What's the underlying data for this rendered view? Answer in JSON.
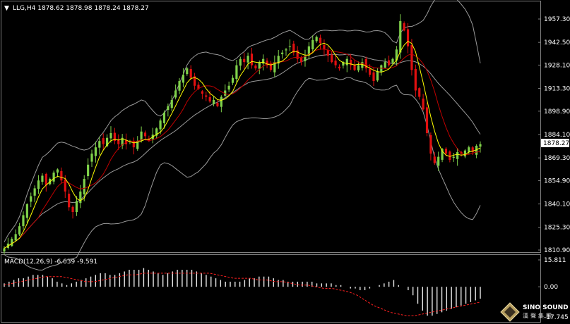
{
  "chart_header": {
    "symbol_arrow": "▼",
    "text": "LLG,H4 1878.62 1878.98 1878.24 1878.27"
  },
  "macd_header": {
    "text": "MACD(12,26,9) -6.639 -9.591"
  },
  "price_axis": {
    "ticks": [
      "1957.30",
      "1942.50",
      "1928.10",
      "1913.30",
      "1898.90",
      "1884.10",
      "1869.30",
      "1854.90",
      "1840.10",
      "1825.30",
      "1810.90"
    ],
    "current_price": "1878.27"
  },
  "macd_axis": {
    "ticks": [
      "15.811",
      "0.00",
      "-17.745"
    ]
  },
  "logo": {
    "name": "SINO SOUND",
    "cn": "漢聲集團"
  },
  "colors": {
    "background": "#000000",
    "bull_candle": "#7fd14a",
    "bear_candle": "#e01010",
    "ma_fast": "#ffff00",
    "ma_mid": "#c00000",
    "bands": "#9a9a9a",
    "macd_hist": "#e8e8e8",
    "macd_signal": "#ff2020",
    "grid_border": "#808080"
  },
  "chart_data": {
    "type": "candlestick",
    "instrument": "LLG",
    "timeframe": "H4",
    "ohlc_last": {
      "open": 1878.62,
      "high": 1878.98,
      "low": 1878.24,
      "close": 1878.27
    },
    "ylim": [
      1810.9,
      1962
    ],
    "closes": [
      1812,
      1815,
      1818,
      1821,
      1826,
      1833,
      1840,
      1845,
      1850,
      1855,
      1858,
      1852,
      1856,
      1860,
      1862,
      1855,
      1848,
      1838,
      1835,
      1842,
      1848,
      1856,
      1865,
      1872,
      1876,
      1880,
      1878,
      1882,
      1885,
      1880,
      1878,
      1882,
      1878,
      1880,
      1876,
      1880,
      1886,
      1883,
      1880,
      1884,
      1888,
      1893,
      1898,
      1902,
      1906,
      1912,
      1918,
      1922,
      1926,
      1920,
      1915,
      1913,
      1910,
      1908,
      1905,
      1906,
      1902,
      1908,
      1912,
      1915,
      1920,
      1928,
      1932,
      1930,
      1934,
      1928,
      1926,
      1930,
      1932,
      1928,
      1925,
      1930,
      1934,
      1936,
      1938,
      1940,
      1936,
      1932,
      1930,
      1934,
      1940,
      1944,
      1946,
      1942,
      1938,
      1934,
      1930,
      1928,
      1926,
      1930,
      1932,
      1928,
      1925,
      1928,
      1930,
      1926,
      1922,
      1918,
      1924,
      1928,
      1930,
      1928,
      1932,
      1938,
      1956,
      1950,
      1940,
      1925,
      1912,
      1908,
      1900,
      1885,
      1872,
      1866,
      1870,
      1875,
      1872,
      1868,
      1870,
      1873,
      1872,
      1874,
      1876,
      1873,
      1877,
      1878
    ],
    "macd": {
      "hist": [
        2,
        3,
        4,
        5,
        5,
        6,
        7,
        7,
        7,
        6,
        5,
        3,
        2,
        1,
        2,
        3,
        4,
        5,
        6,
        7,
        8,
        8,
        7,
        7,
        8,
        9,
        10,
        10,
        10,
        11,
        10,
        9,
        8,
        7,
        8,
        9,
        10,
        10,
        10,
        10,
        9,
        8,
        7,
        6,
        5,
        4,
        3,
        3,
        3,
        3,
        4,
        5,
        5,
        6,
        6,
        6,
        5,
        4,
        4,
        3,
        3,
        3,
        3,
        3,
        3,
        2,
        2,
        2,
        2,
        1,
        1,
        0,
        -1,
        -1,
        -2,
        -2,
        -1,
        0,
        1,
        2,
        3,
        4,
        1,
        0,
        -2,
        -5,
        -10,
        -14,
        -17,
        -17,
        -16,
        -15,
        -14,
        -13,
        -12,
        -11,
        -10,
        -9,
        -8,
        -7
      ],
      "signal": [
        1,
        2,
        3,
        4,
        5,
        6,
        6,
        6,
        5,
        4,
        3,
        3,
        4,
        5,
        6,
        7,
        7,
        8,
        8,
        8,
        8,
        8,
        8,
        8,
        8,
        8,
        7,
        6,
        5,
        5,
        5,
        4,
        4,
        3,
        3,
        2,
        1,
        1,
        0,
        -1,
        -1,
        -2,
        -3,
        -5,
        -8,
        -11,
        -13,
        -15,
        -16,
        -17,
        -17,
        -16,
        -15,
        -14,
        -13,
        -12,
        -11,
        -10,
        -9
      ]
    }
  }
}
